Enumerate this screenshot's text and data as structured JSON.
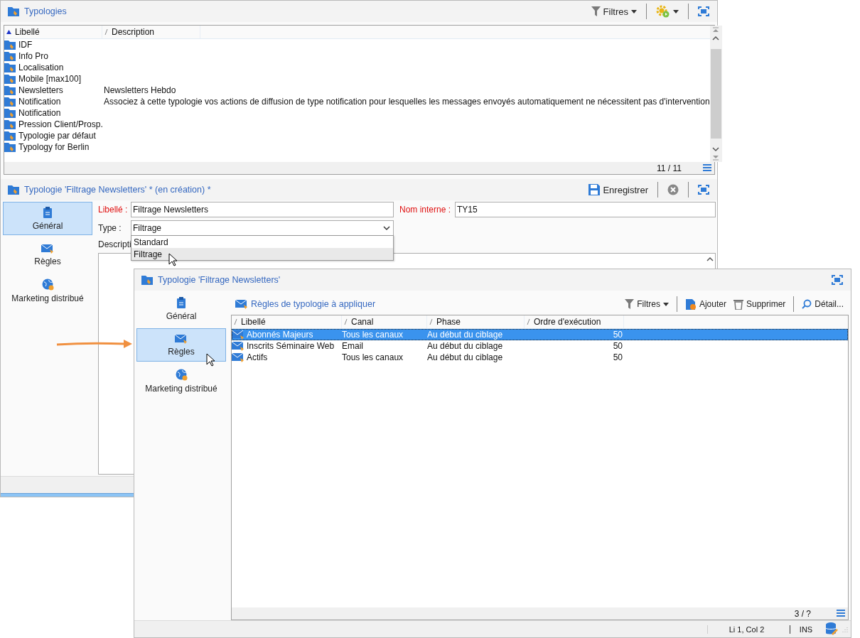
{
  "typologies_window": {
    "list_panel": {
      "title": "Typologies",
      "filters_button": "Filtres",
      "columns": [
        {
          "label": "Libellé",
          "sorted": true
        },
        {
          "label": "Description",
          "sorted": false
        }
      ],
      "rows": [
        {
          "label": "IDF"
        },
        {
          "label": "Info Pro"
        },
        {
          "label": "Localisation"
        },
        {
          "label": "Mobile [max100]"
        },
        {
          "label": "Newsletters",
          "description": "Newsletters Hebdo"
        },
        {
          "label": "Notification",
          "description": "Associez à cette typologie vos actions de diffusion de type notification pour lesquelles les messages envoyés automatiquement ne nécessitent pas d'intervention"
        },
        {
          "label": "Notification"
        },
        {
          "label": "Pression Client/Prosp."
        },
        {
          "label": "Typologie par défaut"
        },
        {
          "label": "Typology for Berlin"
        }
      ],
      "count": "11 / 11"
    },
    "form": {
      "title": "Typologie 'Filtrage Newsletters' * (en création) *",
      "save_button": "Enregistrer",
      "tabs": [
        {
          "label": "Général",
          "kind": "clipboard",
          "selected": true
        },
        {
          "label": "Règles",
          "kind": "envelope",
          "selected": false
        },
        {
          "label": "Marketing distribué",
          "kind": "globe",
          "selected": false
        }
      ],
      "libelle": {
        "label": "Libellé :",
        "value": "Filtrage Newsletters"
      },
      "internal_name": {
        "label": "Nom interne :",
        "value": "TY15"
      },
      "type": {
        "label": "Type :",
        "value": "Filtrage",
        "expanded": true,
        "options": [
          {
            "label": "Standard",
            "hovered": false
          },
          {
            "label": "Filtrage",
            "hovered": true
          }
        ]
      },
      "description": {
        "label": "Descripti"
      }
    }
  },
  "detail_window": {
    "title": "Typologie 'Filtrage Newsletters'",
    "tabs": [
      {
        "label": "Général",
        "kind": "clipboard",
        "selected": false
      },
      {
        "label": "Règles",
        "kind": "envelope",
        "selected": true
      },
      {
        "label": "Marketing distribué",
        "kind": "globe",
        "selected": false
      }
    ],
    "rules_panel": {
      "title": "Règles de typologie à appliquer",
      "toolbar": [
        {
          "label": "Filtres",
          "kind": "filter"
        },
        {
          "label": "Ajouter",
          "kind": "add"
        },
        {
          "label": "Supprimer",
          "kind": "delete"
        },
        {
          "label": "Détail...",
          "kind": "detail"
        }
      ],
      "columns": [
        {
          "label": "Libellé"
        },
        {
          "label": "Canal"
        },
        {
          "label": "Phase"
        },
        {
          "label": "Ordre d'exécution"
        }
      ],
      "rows": [
        {
          "cells": [
            "Abonnés Majeurs",
            "Tous les canaux",
            "Au début du ciblage",
            "50"
          ],
          "selected": true
        },
        {
          "cells": [
            "Inscrits Séminaire Web",
            "Email",
            "Au début du ciblage",
            "50"
          ],
          "selected": false
        },
        {
          "cells": [
            "Actifs",
            "Tous les canaux",
            "Au début du ciblage",
            "50"
          ],
          "selected": false
        }
      ],
      "count": "3 / ?"
    },
    "status_bar": {
      "position": "Li 1, Col 2",
      "mode": "INS"
    }
  }
}
